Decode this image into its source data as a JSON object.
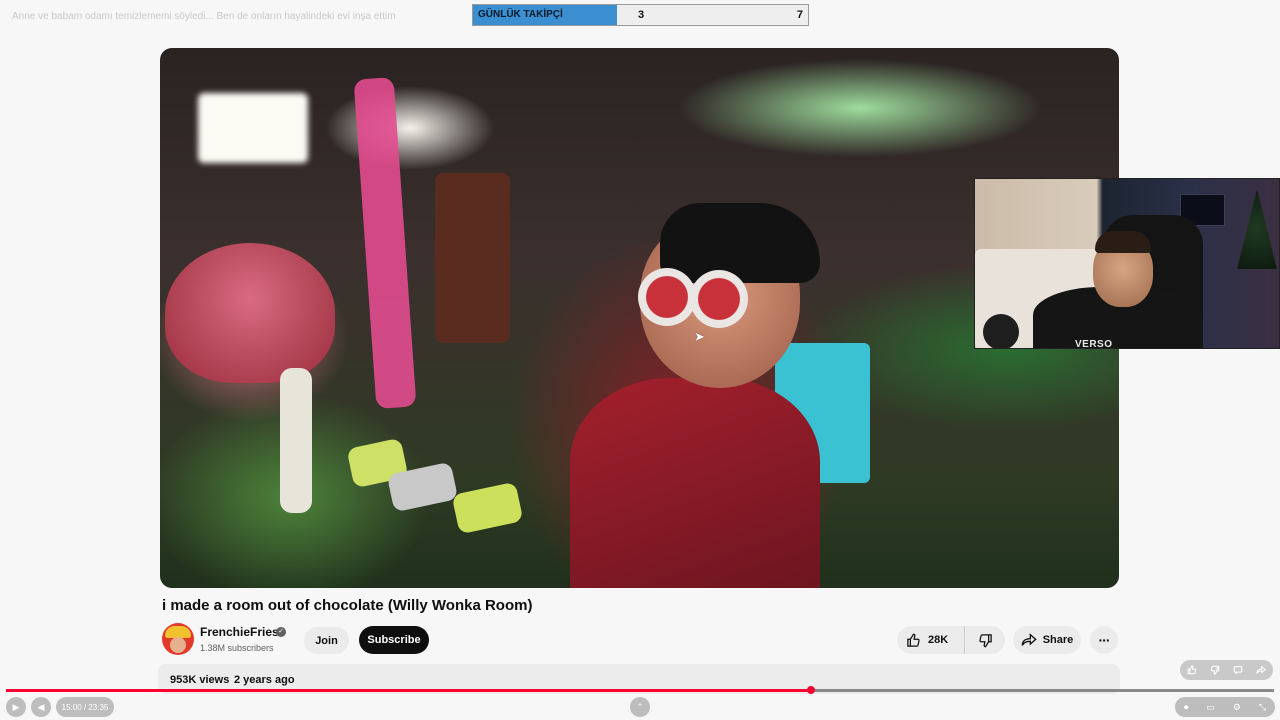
{
  "overlay": {
    "top_title": "Anne ve babam odamı temizlememi söyledi... Ben de onların hayalindeki evi inşa ettim"
  },
  "follower_goal": {
    "label": "GÜNLÜK TAKİPÇİ",
    "current": "3",
    "goal": "7",
    "fill_fraction": 0.43,
    "fill_color": "#3b8fd1"
  },
  "video": {
    "title": "i made a room out of chocolate (Willy Wonka Room)",
    "progress_fraction": 0.635,
    "time_display": "15:00 / 23:35"
  },
  "channel": {
    "name": "FrenchieFries",
    "subscribers": "1.38M subscribers",
    "join_label": "Join",
    "subscribe_label": "Subscribe",
    "verified_icon": "check-circle-icon"
  },
  "actions": {
    "likes": "28K",
    "share_label": "Share",
    "more_label": "···",
    "like_icon": "thumbs-up-icon",
    "dislike_icon": "thumbs-down-icon",
    "share_icon": "share-arrow-icon"
  },
  "description": {
    "views": "953K views",
    "age": "2 years ago"
  },
  "webcam": {
    "shirt_text": "VERSO"
  },
  "colors": {
    "progress": "#ff0033",
    "subscribe_bg": "#0f0f0f",
    "pill_bg": "#ebebeb"
  }
}
